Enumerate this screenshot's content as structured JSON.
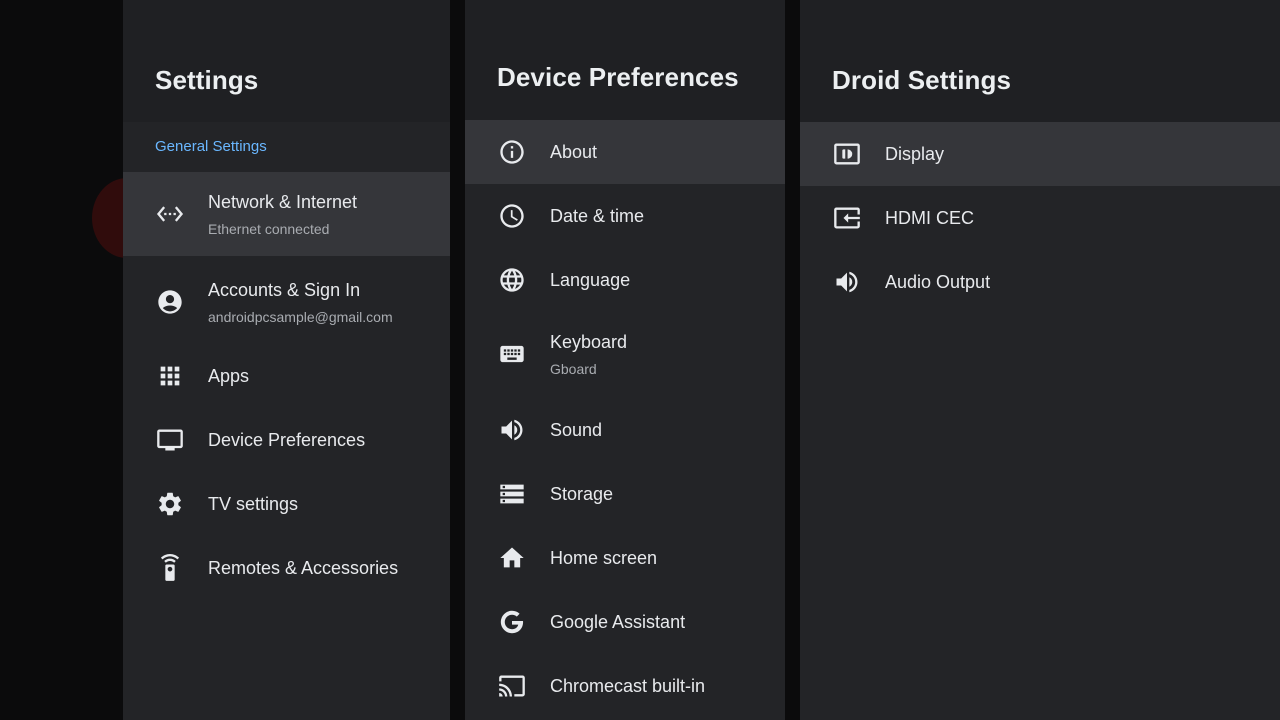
{
  "settings_panel": {
    "title": "Settings",
    "section_label": "General Settings",
    "items": [
      {
        "title": "Network & Internet",
        "subtitle": "Ethernet connected",
        "icon": "network-icon"
      },
      {
        "title": "Accounts & Sign In",
        "subtitle": "androidpcsample@gmail.com",
        "icon": "account-icon"
      },
      {
        "title": "Apps",
        "icon": "apps-grid-icon"
      },
      {
        "title": "Device Preferences",
        "icon": "tv-icon"
      },
      {
        "title": "TV settings",
        "icon": "gear-icon"
      },
      {
        "title": "Remotes & Accessories",
        "icon": "remote-icon"
      }
    ]
  },
  "device_prefs_panel": {
    "title": "Device Preferences",
    "items": [
      {
        "title": "About",
        "icon": "info-icon"
      },
      {
        "title": "Date & time",
        "icon": "clock-icon"
      },
      {
        "title": "Language",
        "icon": "globe-icon"
      },
      {
        "title": "Keyboard",
        "subtitle": "Gboard",
        "icon": "keyboard-icon"
      },
      {
        "title": "Sound",
        "icon": "speaker-icon"
      },
      {
        "title": "Storage",
        "icon": "storage-icon"
      },
      {
        "title": "Home screen",
        "icon": "home-icon"
      },
      {
        "title": "Google Assistant",
        "icon": "google-icon"
      },
      {
        "title": "Chromecast built-in",
        "icon": "cast-icon"
      }
    ]
  },
  "droid_panel": {
    "title": "Droid Settings",
    "items": [
      {
        "title": "Display",
        "icon": "display-icon"
      },
      {
        "title": "HDMI CEC",
        "icon": "hdmi-input-icon"
      },
      {
        "title": "Audio Output",
        "icon": "speaker-icon"
      }
    ]
  },
  "colors": {
    "panel_bg": "#232427",
    "header_bg": "#1f2023",
    "focused_bg": "#35363a",
    "accent": "#6ab7ff",
    "text": "#e8eaed",
    "subtext": "#a9acb1"
  }
}
